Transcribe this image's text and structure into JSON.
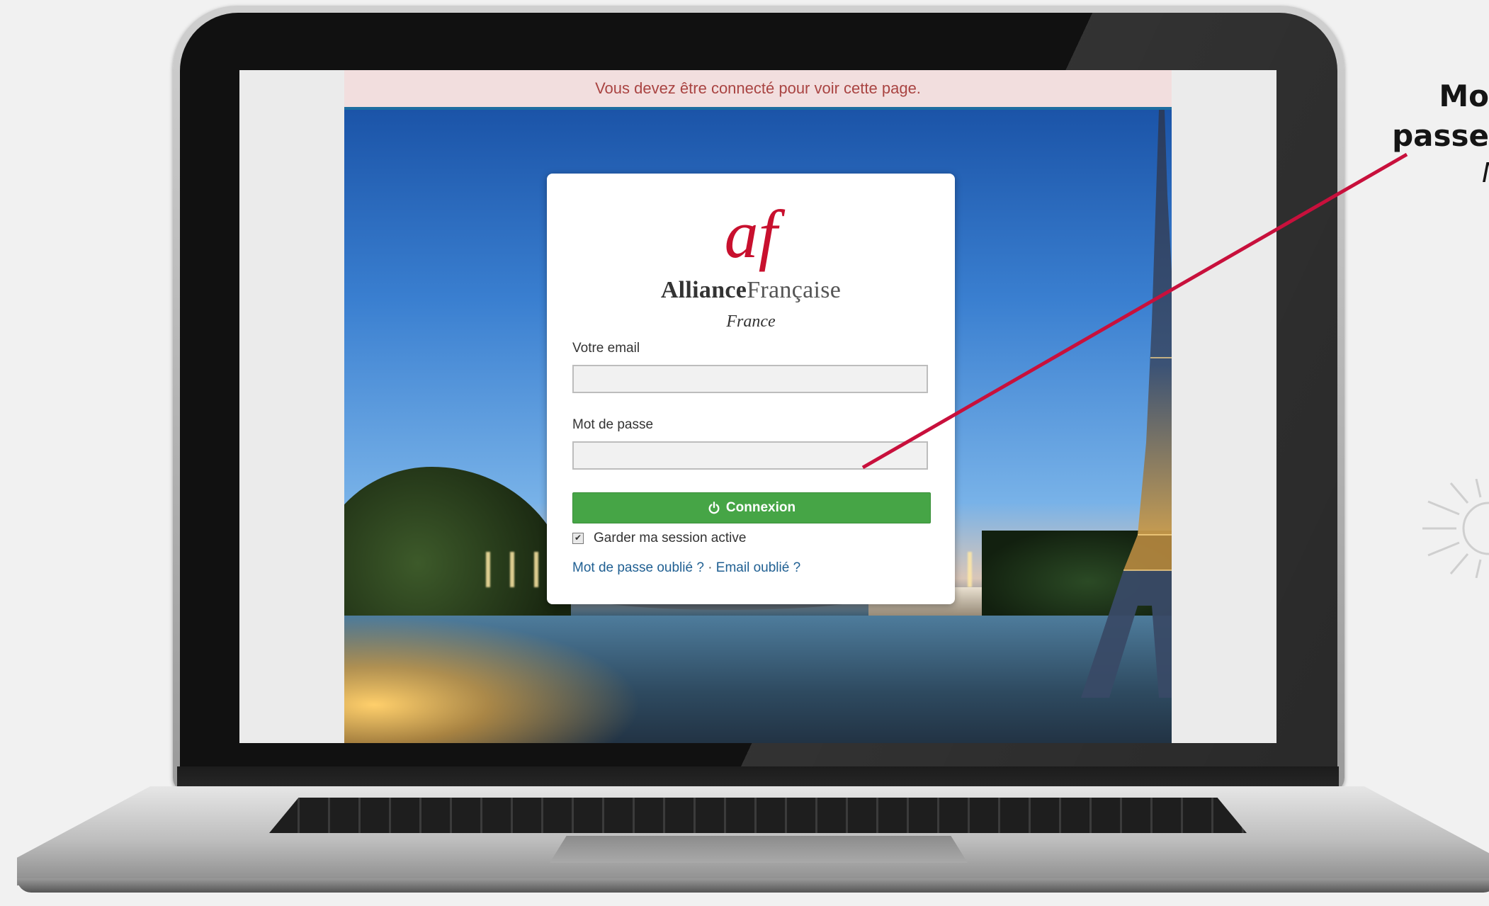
{
  "alert": {
    "message": "Vous devez être connecté pour voir cette page."
  },
  "logo": {
    "mark": "af",
    "name_bold": "Alliance",
    "name_light": "Française",
    "subtitle": "France"
  },
  "form": {
    "email_label": "Votre email",
    "email_value": "",
    "password_label": "Mot de passe",
    "password_value": "",
    "submit_label": "Connexion",
    "submit_icon": "power-icon",
    "remember_label": "Garder ma session active",
    "remember_checked": true,
    "forgot_password": "Mot de passe oublié ?",
    "separator": "·",
    "forgot_email": "Email oublié ?"
  },
  "annotation": {
    "line1": "Mo",
    "line2": "passe",
    "line3": "M"
  },
  "colors": {
    "brand": "#c8102e",
    "button": "#46a546",
    "alert_text": "#a94442",
    "link": "#1f5f92",
    "pointer": "#c8103c"
  }
}
